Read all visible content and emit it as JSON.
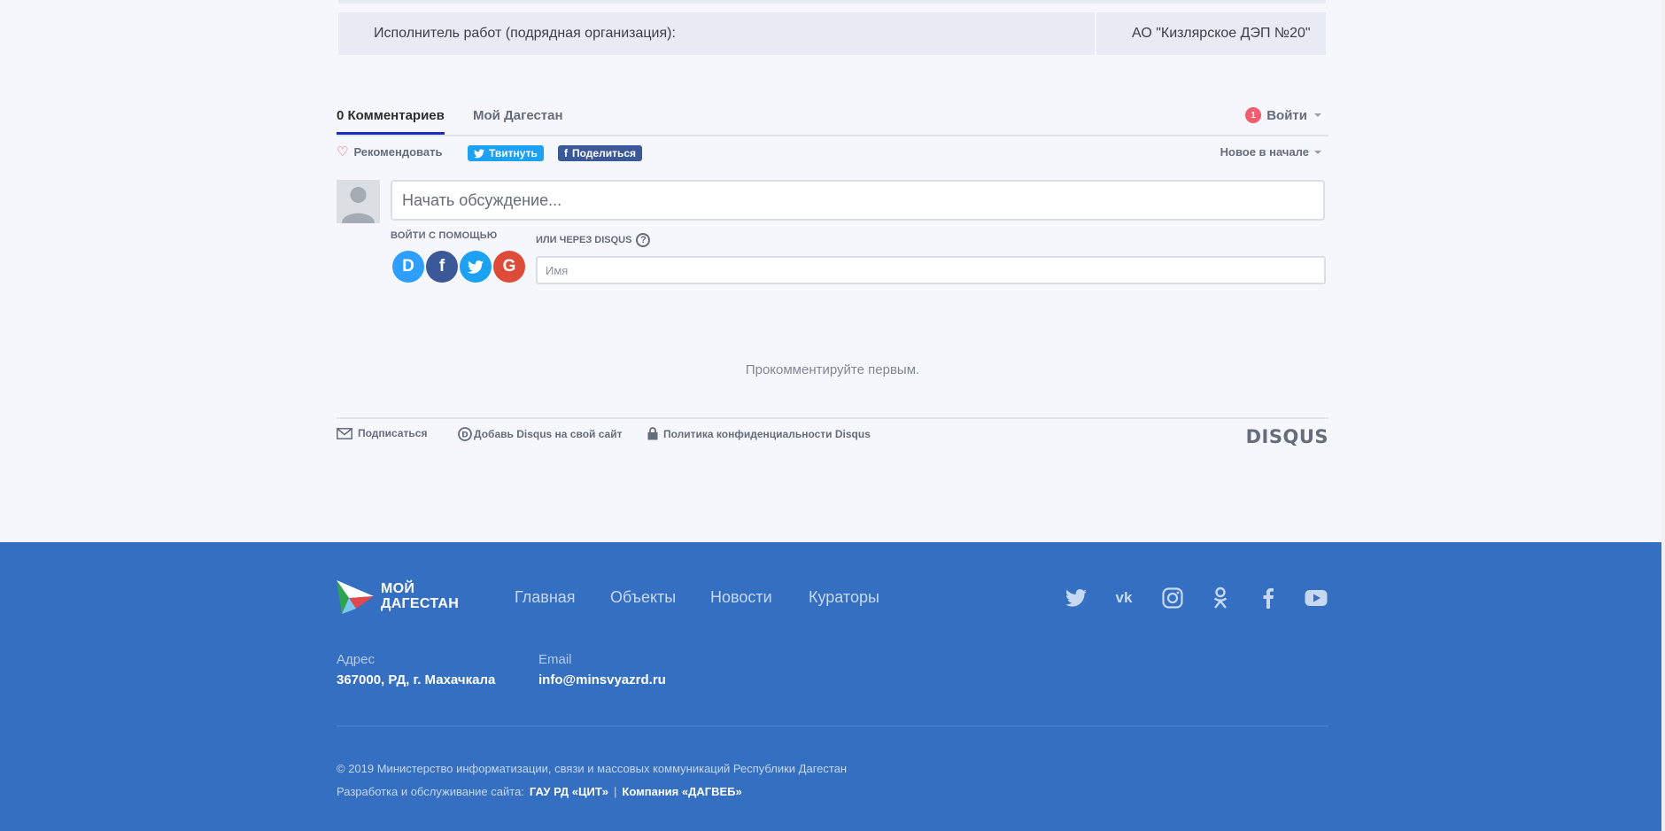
{
  "info_table": {
    "label": "Исполнитель работ (подрядная организация):",
    "value": "АО \"Кизлярское ДЭП №20\""
  },
  "disqus": {
    "tab_comments": "0 Комментариев",
    "tab_site": "Мой Дагестан",
    "login_badge": "1",
    "login_label": "Войти",
    "recommend_label": "Рекомендовать",
    "tweet_label": "Твитнуть",
    "share_label": "Поделиться",
    "sort_label": "Новое в начале",
    "comment_placeholder": "Начать обсуждение...",
    "login_with": "войти с помощью",
    "or_disqus": "или через disqus",
    "social_icons": [
      "disqus-icon",
      "facebook-icon",
      "twitter-icon",
      "google-icon"
    ],
    "name_placeholder": "Имя",
    "empty_message": "Прокомментируйте первым.",
    "footer_subscribe": "Подписаться",
    "footer_add": "Добавь Disqus на свой сайт",
    "footer_privacy": "Политика конфиденциальности Disqus",
    "logo": "DISQUS"
  },
  "footer": {
    "logo_line1": "МОЙ",
    "logo_line2": "ДАГЕСТАН",
    "nav": [
      "Главная",
      "Объекты",
      "Новости",
      "Кураторы"
    ],
    "social_icons": [
      "twitter-icon",
      "vk-icon",
      "instagram-icon",
      "odnoklassniki-icon",
      "facebook-icon",
      "youtube-icon"
    ],
    "address_label": "Адрес",
    "address_value": "367000, РД, г. Махачкала",
    "email_label": "Email",
    "email_value": "info@minsvyazrd.ru",
    "copyright": "© 2019 Министерство информатизации, связи и массовых коммуникаций Республики Дагестан",
    "dev_prefix": "Разработка и обслуживание сайта:",
    "dev_link1": "ГАУ РД «ЦИТ»",
    "dev_sep": "|",
    "dev_link2": "Компания «ДАГВЕБ»"
  },
  "colors": {
    "footer_bg": "#356fc1",
    "page_bg": "#f5f7fc",
    "twitter": "#1da1f2",
    "facebook": "#3b5998",
    "badge": "#f05f70"
  }
}
